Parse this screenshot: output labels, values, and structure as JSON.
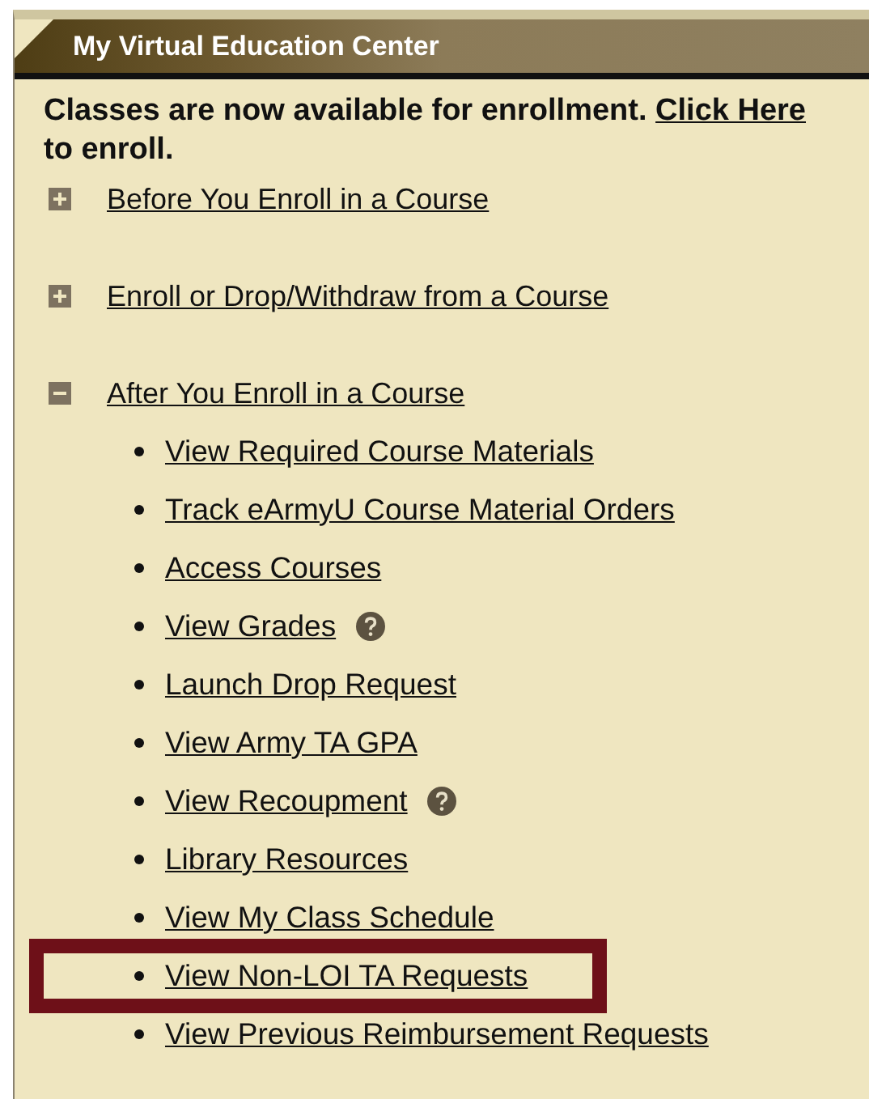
{
  "panel": {
    "title": "My Virtual Education Center"
  },
  "notice": "**Classes are now available for enrollment.** ",
  "notice_link": "Click Here",
  "notice_end": " to enroll.",
  "sections": [
    {
      "label": "Before You Enroll in a Course",
      "expanded": false
    },
    {
      "label": "Enroll or Drop/Withdraw from a Course",
      "expanded": false
    },
    {
      "label": "After You Enroll in a Course",
      "expanded": true,
      "children": [
        {
          "label": "View Required Course Materials",
          "help": false,
          "highlighted": false
        },
        {
          "label": "Track eArmyU Course Material Orders",
          "help": false,
          "highlighted": false
        },
        {
          "label": "Access Courses",
          "help": false,
          "highlighted": false
        },
        {
          "label": "View Grades",
          "help": true,
          "highlighted": false
        },
        {
          "label": "Launch Drop Request",
          "help": false,
          "highlighted": false
        },
        {
          "label": "View Army TA GPA",
          "help": false,
          "highlighted": false
        },
        {
          "label": "View Recoupment ",
          "help": true,
          "highlighted": false
        },
        {
          "label": "Library Resources",
          "help": false,
          "highlighted": false
        },
        {
          "label": "View My Class Schedule",
          "help": false,
          "highlighted": false
        },
        {
          "label": "View Non-LOI TA Requests",
          "help": false,
          "highlighted": true
        },
        {
          "label": "View Previous Reimbursement Requests",
          "help": false,
          "highlighted": false
        }
      ]
    }
  ]
}
